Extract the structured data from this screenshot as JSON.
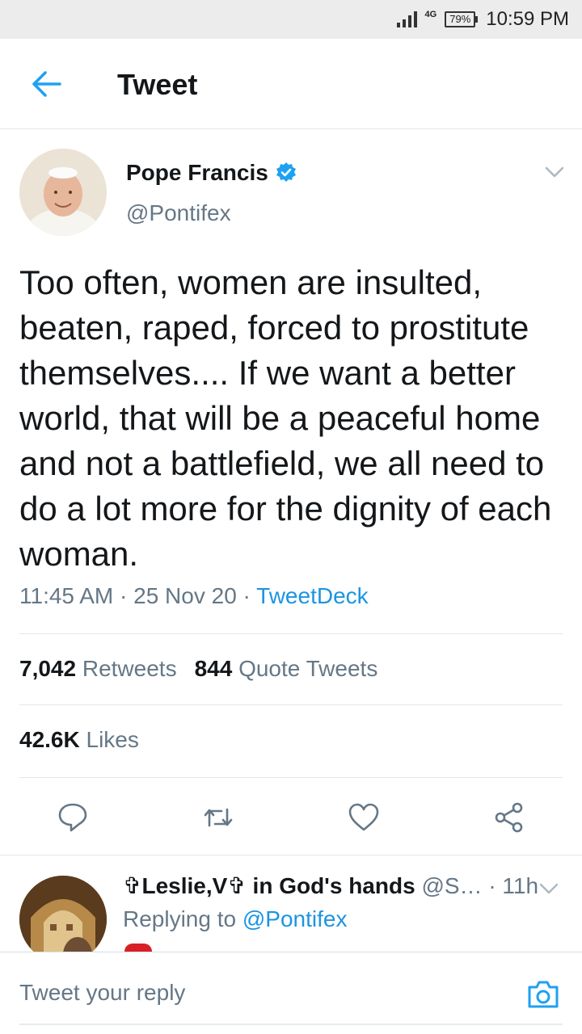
{
  "status_bar": {
    "network": "4G",
    "battery": "79%",
    "time": "10:59 PM"
  },
  "header": {
    "title": "Tweet",
    "back_icon": "back-arrow-icon"
  },
  "tweet": {
    "author_name": "Pope Francis",
    "handle": "@Pontifex",
    "text": "Too often, women are insulted, beaten, raped, forced to prostitute themselves.... If we want a better world, that will be a peaceful home and not a battlefield, we all need to do a lot more for the dignity of each woman.",
    "time": "11:45 AM",
    "date": "25 Nov 20",
    "source": "TweetDeck",
    "separator": "·",
    "retweets_count": "7,042",
    "retweets_label": "Retweets",
    "quotes_count": "844",
    "quotes_label": "Quote Tweets",
    "likes_count": "42.6K",
    "likes_label": "Likes"
  },
  "reply": {
    "name": "✞Leslie,V✞ in God's hands",
    "handle": "@S…",
    "time": "· 11h",
    "replying_to_label": "Replying to",
    "replying_to": "@Pontifex"
  },
  "compose": {
    "placeholder": "Tweet your reply"
  },
  "colors": {
    "accent": "#1da1f2",
    "link": "#1b95e0",
    "muted": "#657786",
    "text": "#14171a",
    "divider": "#e1e8ed"
  }
}
